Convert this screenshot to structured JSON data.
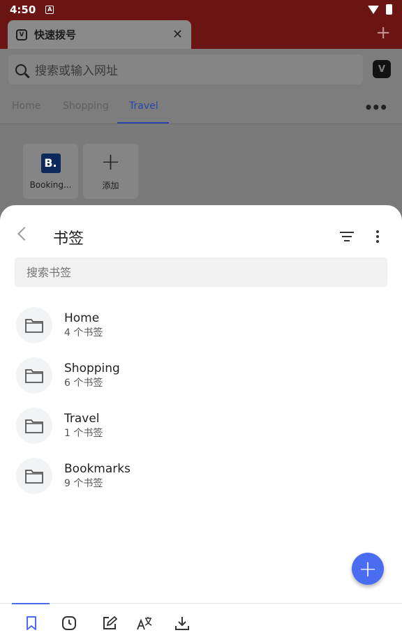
{
  "status_bar": {
    "time": "4:50",
    "notif_letter": "A"
  },
  "tab": {
    "title": "快速拨号",
    "close": "✕",
    "new_tab": "+"
  },
  "address_bar": {
    "placeholder": "搜索或输入网址",
    "vivaldi_letter": "V"
  },
  "speed_dial": {
    "tabs": [
      {
        "label": "Home"
      },
      {
        "label": "Shopping"
      },
      {
        "label": "Travel"
      }
    ],
    "more": "•••",
    "tiles": [
      {
        "label": "Booking...",
        "logo": "B."
      },
      {
        "label": "添加",
        "icon": "+"
      }
    ]
  },
  "sheet": {
    "title": "书签",
    "search_placeholder": "搜索书签",
    "folders": [
      {
        "name": "Home",
        "count": "4 个书签"
      },
      {
        "name": "Shopping",
        "count": "6 个书签"
      },
      {
        "name": "Travel",
        "count": "1 个书签"
      },
      {
        "name": "Bookmarks",
        "count": "9 个书签"
      }
    ],
    "fab": "+"
  },
  "bottom_nav": {
    "items": [
      "bookmark-icon",
      "history-icon",
      "notes-icon",
      "translate-icon",
      "download-icon"
    ],
    "active_color": "#4a6cf0"
  },
  "colors": {
    "accent": "#4a6cf0",
    "toolbar_red": "#6a1414",
    "travel_active": "#2846a8"
  }
}
